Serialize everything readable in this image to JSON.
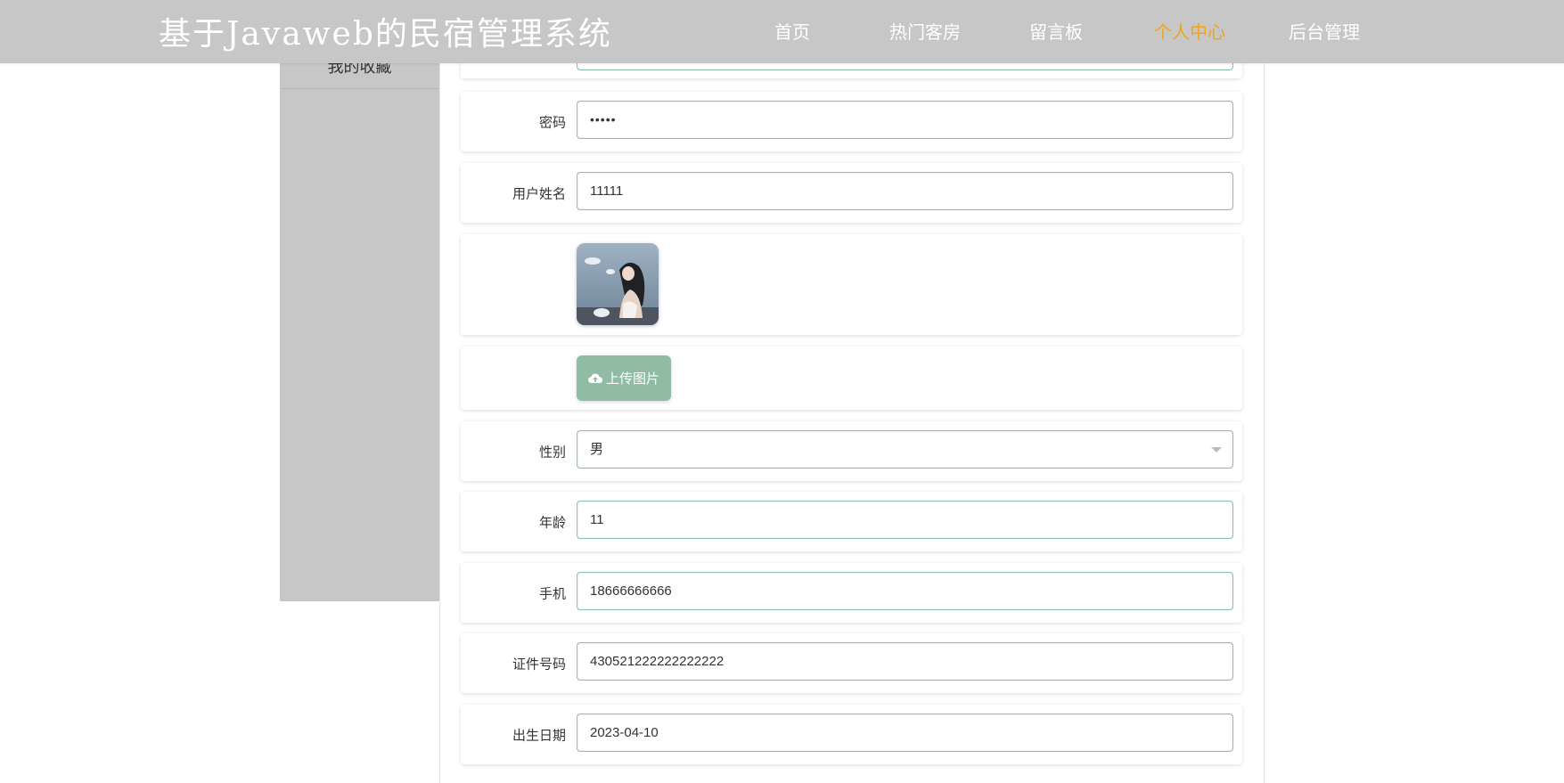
{
  "header": {
    "title": "基于Javaweb的民宿管理系统",
    "nav": [
      "首页",
      "热门客房",
      "留言板",
      "个人中心",
      "后台管理"
    ],
    "active": "个人中心",
    "active_color": "#f2a417"
  },
  "sidebar": {
    "items": [
      "我的收藏"
    ]
  },
  "form": {
    "password": {
      "label": "密码",
      "value": "•••••"
    },
    "name": {
      "label": "用户姓名",
      "value": "11111"
    },
    "avatar": {
      "icon": "avatar-image"
    },
    "upload": {
      "label": "上传图片",
      "icon": "cloud-upload-icon"
    },
    "gender": {
      "label": "性别",
      "value": "男"
    },
    "age": {
      "label": "年龄",
      "value": "11"
    },
    "phone": {
      "label": "手机",
      "value": "18666666666"
    },
    "id_number": {
      "label": "证件号码",
      "value": "430521222222222222"
    },
    "birthday": {
      "label": "出生日期",
      "value": "2023-04-10"
    }
  },
  "colors": {
    "header_bg": "#c7c7c7",
    "field_border": "#8cc1a4",
    "upload_button": "#8fbca3"
  }
}
